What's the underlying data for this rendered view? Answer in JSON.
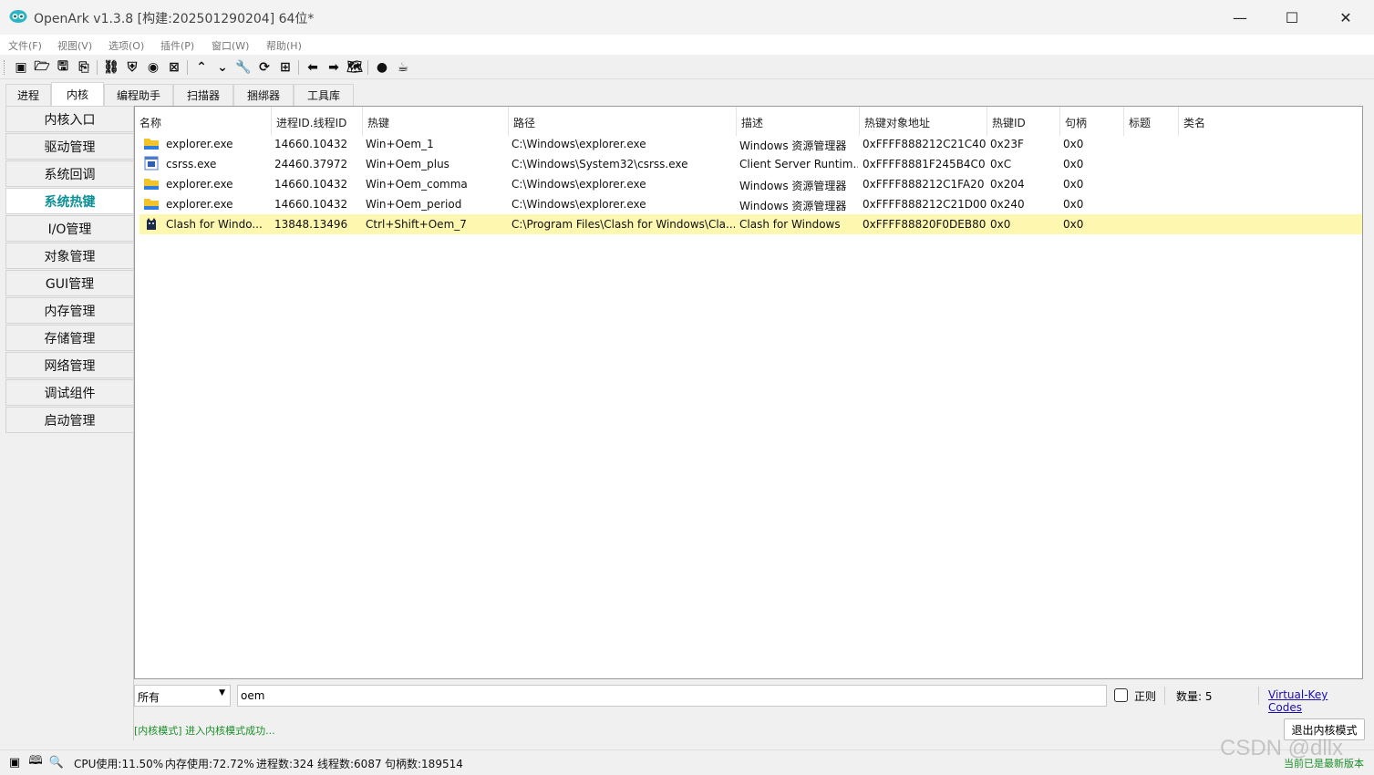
{
  "window": {
    "title": "OpenArk v1.3.8 [构建:202501290204]  64位*",
    "minimize": "—",
    "maximize": "☐",
    "close": "✕"
  },
  "menu": [
    "文件(F)",
    "视图(V)",
    "选项(O)",
    "插件(P)",
    "窗口(W)",
    "帮助(H)"
  ],
  "toolbar_icons": [
    "console-icon",
    "open-folder-icon",
    "save-icon",
    "export-icon",
    "link-icon",
    "shield-icon",
    "eye-icon",
    "close-box-icon",
    "up-icon",
    "down-icon",
    "wrench-icon",
    "refresh-icon",
    "grid-icon",
    "back-icon",
    "forward-icon",
    "map-icon",
    "github-icon",
    "cup-icon"
  ],
  "tabs": [
    "进程",
    "内核",
    "编程助手",
    "扫描器",
    "捆绑器",
    "工具库"
  ],
  "sidebar": [
    "内核入口",
    "驱动管理",
    "系统回调",
    "系统热键",
    "I/O管理",
    "对象管理",
    "GUI管理",
    "内存管理",
    "存储管理",
    "网络管理",
    "调试组件",
    "启动管理"
  ],
  "table": {
    "headers": [
      "名称",
      "进程ID.线程ID",
      "热键",
      "路径",
      "描述",
      "热键对象地址",
      "热键ID",
      "句柄",
      "标题",
      "类名"
    ],
    "rows": [
      {
        "name": "explorer.exe",
        "pid": "14660.10432",
        "hotkey": "Win+Oem_1",
        "path": "C:\\Windows\\explorer.exe",
        "desc": "Windows 资源管理器",
        "addr": "0xFFFF888212C21C40",
        "id": "0x23F",
        "handle": "0x0",
        "title": "",
        "cls": "",
        "icon": "folder-icon"
      },
      {
        "name": "csrss.exe",
        "pid": "24460.37972",
        "hotkey": "Win+Oem_plus",
        "path": "C:\\Windows\\System32\\csrss.exe",
        "desc": "Client Server Runtim...",
        "addr": "0xFFFF8881F245B4C0",
        "id": "0xC",
        "handle": "0x0",
        "title": "",
        "cls": "",
        "icon": "app-window-icon"
      },
      {
        "name": "explorer.exe",
        "pid": "14660.10432",
        "hotkey": "Win+Oem_comma",
        "path": "C:\\Windows\\explorer.exe",
        "desc": "Windows 资源管理器",
        "addr": "0xFFFF888212C1FA20",
        "id": "0x204",
        "handle": "0x0",
        "title": "",
        "cls": "",
        "icon": "folder-icon"
      },
      {
        "name": "explorer.exe",
        "pid": "14660.10432",
        "hotkey": "Win+Oem_period",
        "path": "C:\\Windows\\explorer.exe",
        "desc": "Windows 资源管理器",
        "addr": "0xFFFF888212C21D00",
        "id": "0x240",
        "handle": "0x0",
        "title": "",
        "cls": "",
        "icon": "folder-icon"
      },
      {
        "name": "Clash for Windo...",
        "pid": "13848.13496",
        "hotkey": "Ctrl+Shift+Oem_7",
        "path": "C:\\Program Files\\Clash for Windows\\Cla...",
        "desc": "Clash for Windows",
        "addr": "0xFFFF88820F0DEB80",
        "id": "0x0",
        "handle": "0x0",
        "title": "",
        "cls": "",
        "icon": "cat-icon"
      }
    ]
  },
  "filter": {
    "scope": "所有",
    "query": "oem",
    "regex_label": "正则",
    "count_label": "数量:  5",
    "vk_link": "Virtual-Key Codes"
  },
  "log": "[内核模式] 进入内核模式成功...",
  "exit_button": "退出内核模式",
  "status": {
    "cpu": "CPU使用:11.50%",
    "mem": "内存使用:72.72%",
    "procs": "进程数:324",
    "threads": "线程数:6087",
    "handles": "句柄数:189514",
    "update": "当前已是最新版本"
  },
  "watermark": "CSDN @dllx",
  "colors": {
    "accent": "#0d8f95",
    "selected_row": "#fdf7b0",
    "success": "#1c8e2a",
    "link": "#1a0dab"
  }
}
